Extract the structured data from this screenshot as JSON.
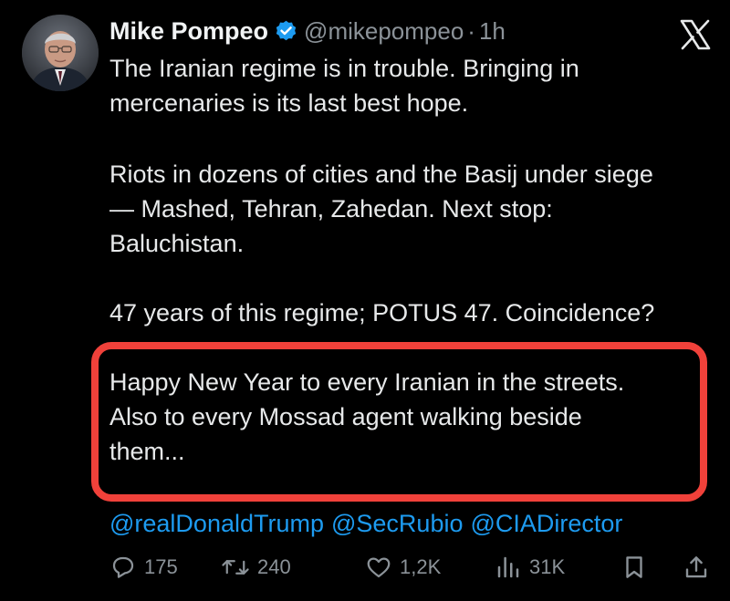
{
  "author": {
    "display_name": "Mike Pompeo",
    "handle": "@mikepompeo",
    "separator": "·",
    "time": "1h",
    "verified": true
  },
  "icons": {
    "avatar": "avatar",
    "verified": "verified-badge-icon",
    "platform": "x-logo-icon",
    "reply": "reply-icon",
    "retweet": "retweet-icon",
    "like": "like-icon",
    "views": "views-icon",
    "bookmark": "bookmark-icon",
    "share": "share-icon"
  },
  "tweet": {
    "paragraphs": [
      [
        "The Iranian regime is in trouble. Bringing in",
        "mercenaries is its last best hope."
      ],
      [
        "Riots in dozens of cities and the Basij under siege",
        "— Mashed, Tehran, Zahedan.  Next stop:",
        "Baluchistan."
      ],
      [
        "47 years of this regime; POTUS 47.  Coincidence?"
      ],
      [
        "Happy New Year to every Iranian in the streets.",
        "Also to every Mossad agent walking beside",
        "them..."
      ]
    ],
    "mentions": [
      "@realDonaldTrump",
      "@SecRubio",
      "@CIADirector"
    ]
  },
  "metrics": {
    "replies": "175",
    "retweets": "240",
    "likes": "1,2K",
    "views": "31K"
  },
  "colors": {
    "background": "#000000",
    "text": "#e7e9ea",
    "muted": "#8b9298",
    "link": "#1d9bf0",
    "verified_badge": "#1d9bf0",
    "highlight_border": "#f0413a"
  }
}
